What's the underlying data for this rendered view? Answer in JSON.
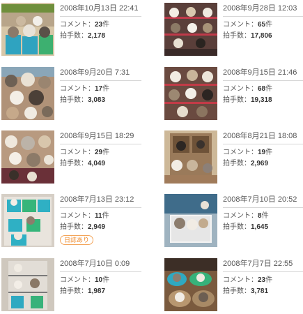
{
  "labels": {
    "comment": "コメント：",
    "comment_unit": "件",
    "applause": "拍手数：",
    "diary_badge": "日誌あり"
  },
  "entries": [
    {
      "date": "2008年10月13日 22:41",
      "comments": "23",
      "applause": "2,178",
      "scene": "green-bins-cats"
    },
    {
      "date": "2008年9月28日 12:03",
      "comments": "65",
      "applause": "17,806",
      "scene": "shelf-cats"
    },
    {
      "date": "2008年9月20日 7:31",
      "comments": "17",
      "applause": "3,083",
      "scene": "cat-pile"
    },
    {
      "date": "2008年9月15日 21:46",
      "comments": "68",
      "applause": "19,318",
      "scene": "shelf-cats-2"
    },
    {
      "date": "2008年9月15日 18:29",
      "comments": "29",
      "applause": "4,049",
      "scene": "cat-pile-2"
    },
    {
      "date": "2008年8月21日 18:08",
      "comments": "19",
      "applause": "2,969",
      "scene": "cat-cabinet"
    },
    {
      "date": "2008年7月13日 23:12",
      "comments": "11",
      "applause": "2,949",
      "scene": "teal-bins-cats",
      "diary": true
    },
    {
      "date": "2008年7月10日 20:52",
      "comments": "8",
      "applause": "1,645",
      "scene": "box-cats"
    },
    {
      "date": "2008年7月10日 0:09",
      "comments": "10",
      "applause": "1,987",
      "scene": "rack-cats"
    },
    {
      "date": "2008年7月7日 22:55",
      "comments": "23",
      "applause": "3,781",
      "scene": "basket-cats"
    }
  ]
}
